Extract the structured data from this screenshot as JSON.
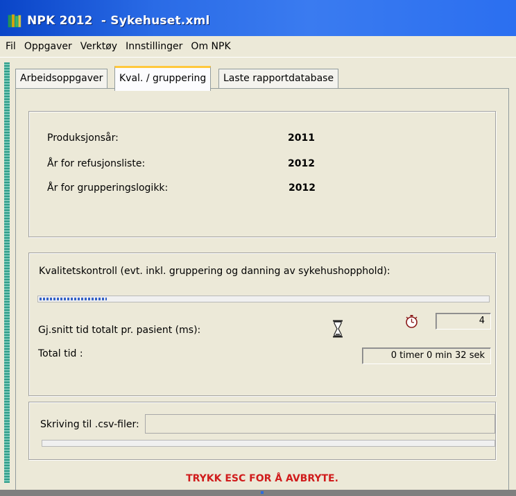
{
  "window": {
    "title": "NPK 2012  - Sykehuset.xml",
    "icon": "app-books-icon"
  },
  "menu": {
    "items": [
      "Fil",
      "Oppgaver",
      "Verktøy",
      "Innstillinger",
      "Om NPK"
    ]
  },
  "tabs": [
    {
      "label": "Arbeidsoppgaver"
    },
    {
      "label": "Kval. / gruppering"
    },
    {
      "label": "Laste rapportdatabase"
    }
  ],
  "active_tab": "Kval. / gruppering",
  "years": {
    "production_label": "Produksjonsår:",
    "production_value": "2011",
    "refund_label": "År for refusjonsliste:",
    "refund_value": "2012",
    "grouping_label": "År for grupperingslogikk:",
    "grouping_value": "2012"
  },
  "quality": {
    "heading": "Kvalitetskontroll (evt. inkl. gruppering og danning av sykehushopphold):",
    "progress_fraction": 0.15,
    "avg_label": "Gj.snitt tid totalt pr. pasient (ms):",
    "avg_value": "4",
    "total_label": "Total tid :",
    "total_value": "0 timer 0 min 32 sek",
    "hourglass_icon": "hourglass-icon",
    "stopwatch_icon": "stopwatch-icon"
  },
  "csv": {
    "label": "Skriving til .csv-filer:",
    "field_value": "",
    "progress_fraction": 0
  },
  "abort_text": "TRYKK ESC FOR Å AVBRYTE.",
  "colors": {
    "titlebar": "#2A6BE6",
    "abort": "#D01C1C",
    "progress": "#3462C8",
    "active_tab_accent": "#FFC83C"
  }
}
